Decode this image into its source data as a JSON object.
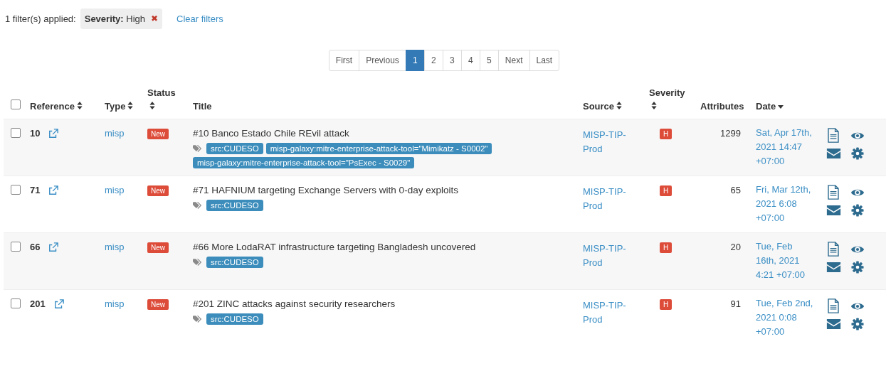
{
  "filters": {
    "summary": "1 filter(s) applied:",
    "items": [
      {
        "field": "Severity:",
        "value": "High",
        "remove": "✖"
      }
    ],
    "clear": "Clear filters"
  },
  "pagination": [
    {
      "label": "First",
      "selected": false
    },
    {
      "label": "Previous",
      "selected": false
    },
    {
      "label": "1",
      "selected": true
    },
    {
      "label": "2",
      "selected": false
    },
    {
      "label": "3",
      "selected": false
    },
    {
      "label": "4",
      "selected": false
    },
    {
      "label": "5",
      "selected": false
    },
    {
      "label": "Next",
      "selected": false
    },
    {
      "label": "Last",
      "selected": false
    }
  ],
  "table": {
    "select_all": {
      "checked": false
    },
    "columns": [
      {
        "label": "Reference",
        "kind": "sortable"
      },
      {
        "label": "Type",
        "kind": "sortable"
      },
      {
        "label": "Status",
        "kind": "sortable"
      },
      {
        "label": "Title",
        "kind": "plain"
      },
      {
        "label": "Source",
        "kind": "sortable"
      },
      {
        "label": "Severity",
        "kind": "sortable"
      },
      {
        "label": "Attributes",
        "kind": "plain"
      },
      {
        "label": "Date",
        "kind": "sorted"
      }
    ],
    "rows": [
      {
        "checked": false,
        "reference": "10",
        "type": "misp",
        "status": "New",
        "title": "#10 Banco Estado Chile REvil attack",
        "tags": [
          "src:CUDESO",
          "misp-galaxy:mitre-enterprise-attack-tool=\"Mimikatz - S0002\"",
          "misp-galaxy:mitre-enterprise-attack-tool=\"PsExec - S0029\""
        ],
        "source": "MISP-TIP-Prod",
        "severity": "H",
        "attributes": "1299",
        "date": "Sat, Apr 17th, 2021 14:47 +07:00"
      },
      {
        "checked": false,
        "reference": "71",
        "type": "misp",
        "status": "New",
        "title": "#71 HAFNIUM targeting Exchange Servers with 0-day exploits",
        "tags": [
          "src:CUDESO"
        ],
        "source": "MISP-TIP-Prod",
        "severity": "H",
        "attributes": "65",
        "date": "Fri, Mar 12th, 2021 6:08 +07:00"
      },
      {
        "checked": false,
        "reference": "66",
        "type": "misp",
        "status": "New",
        "title": "#66 More LodaRAT infrastructure targeting Bangladesh uncovered",
        "tags": [
          "src:CUDESO"
        ],
        "source": "MISP-TIP-Prod",
        "severity": "H",
        "attributes": "20",
        "date": "Tue, Feb 16th, 2021 4:21 +07:00"
      },
      {
        "checked": false,
        "reference": "201",
        "type": "misp",
        "status": "New",
        "title": "#201 ZINC attacks against security researchers",
        "tags": [
          "src:CUDESO"
        ],
        "source": "MISP-TIP-Prod",
        "severity": "H",
        "attributes": "91",
        "date": "Tue, Feb 2nd, 2021 0:08 +07:00"
      }
    ]
  }
}
